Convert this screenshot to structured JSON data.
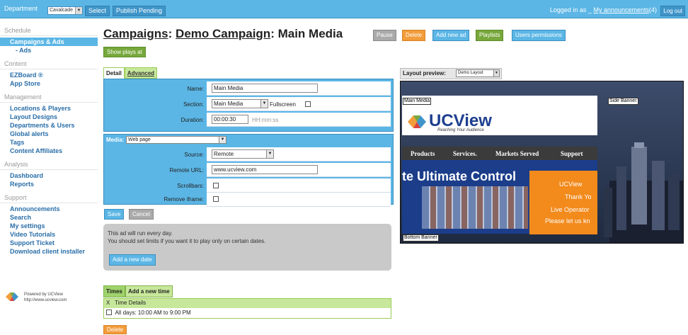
{
  "topbar": {
    "department_label": "Department",
    "department_value": "Cavalcade",
    "select_button": "Select",
    "publish_button": "Publish Pending",
    "logged_prefix": "Logged in as _",
    "announcements_link": "My announcements",
    "announcements_count": "(4)",
    "logout_button": "Log out"
  },
  "sidebar": {
    "sections": {
      "schedule": "Schedule",
      "content": "Content",
      "management": "Management",
      "analysis": "Analysis",
      "support": "Support"
    },
    "schedule_items": [
      "Campaigns & Ads",
      "- Ads"
    ],
    "content_items": [
      "EZBoard ®",
      "App Store"
    ],
    "management_items": [
      "Locations & Players",
      "Layout Designs",
      "Departments & Users",
      "Global alerts",
      "Tags",
      "Content Affiliates"
    ],
    "analysis_items": [
      "Dashboard",
      "Reports"
    ],
    "support_items": [
      "Announcements",
      "Search",
      "My settings",
      "Video Tutorials",
      "Support Ticket",
      "Download client installer"
    ],
    "powered_line1": "Powered by UCView",
    "powered_line2": "http://www.ucview.com"
  },
  "header": {
    "crumb1": "Campaigns",
    "sep1": ":",
    "crumb2": "Demo Campaign",
    "sep2": ":",
    "crumb3": "Main Media",
    "buttons": {
      "pause": "Pause",
      "delete": "Delete",
      "add_new_ad": "Add new ad",
      "playlists": "Playlists",
      "users_permissions": "Users permissions"
    },
    "show_plays": "Show plays at"
  },
  "tabs": {
    "detail": "Detail",
    "advanced": "Advanced"
  },
  "form": {
    "name_label": "Name:",
    "name_value": "Main Media",
    "section_label": "Section:",
    "section_value": "Main Media",
    "fullscreen_label": "Fullscreen",
    "duration_label": "Duration:",
    "duration_value": "00:00:30",
    "duration_hint": "HH:mm:ss",
    "media_label": "Media:",
    "media_value": "Web page",
    "source_label": "Source:",
    "source_value": "Remote",
    "remote_url_label": "Remote URL:",
    "remote_url_value": "www.ucview.com",
    "scrollbars_label": "Scrollbars:",
    "remove_iframe_label": "Remove iframe:",
    "save_button": "Save",
    "cancel_button": "Cancel"
  },
  "notice": {
    "line1": "This ad will run every day.",
    "line2": "You should set limits if you want it to play only on certain dates.",
    "add_date_button": "Add a new date"
  },
  "times": {
    "tab_times": "Times",
    "tab_add": "Add a new time",
    "col_x": "X",
    "col_details": "Time Details",
    "row1": "All days: 10:00 AM to 9:00 PM",
    "delete_button": "Delete"
  },
  "preview": {
    "label": "Layout preview:",
    "select_value": "Demo Layout",
    "zone_main": "Main Media",
    "zone_side": "Side Banner",
    "zone_bottom": "Bottom Banner",
    "site_logo_text": "UCView",
    "site_tagline": "Reaching Your Audience",
    "site_nav": [
      "Products",
      "Services.",
      "Markets Served",
      "Support"
    ],
    "site_hero": "te Ultimate Control",
    "chat_lines": [
      "UCView",
      "Thank Yo",
      "Live Operator",
      "Please let us kn"
    ]
  },
  "colors": {
    "topbar": "#5bb6e5",
    "accent_orange": "#f29c3a",
    "accent_green": "#77a83b",
    "tab_green": "#c7e89b"
  }
}
